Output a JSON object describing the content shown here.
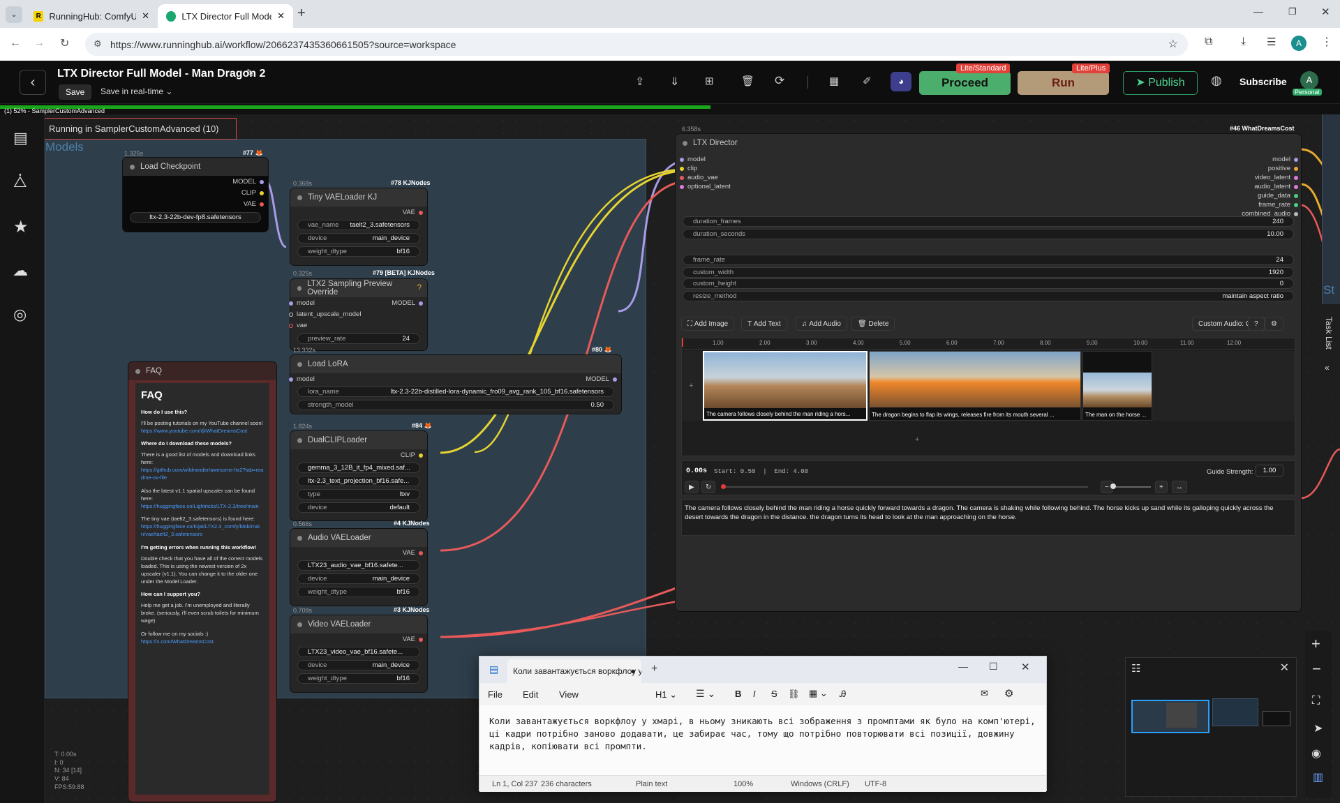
{
  "browser": {
    "tabs": [
      {
        "title": "RunningHub: ComfyUI Cloud, C",
        "favicon": "R"
      },
      {
        "title": "LTX Director Full Model - Man D",
        "favicon": "rh"
      }
    ],
    "url": "https://www.runninghub.ai/workflow/2066237435360661505?source=workspace",
    "profile_initial": "A"
  },
  "app": {
    "workflow_title": "LTX Director Full Model - Man Dragon 2",
    "save_label": "Save",
    "save_mode": "Save in real-time",
    "proceed_label": "Proceed",
    "proceed_badge": "Lite/Standard",
    "run_label": "Run",
    "run_badge": "Lite/Plus",
    "publish_label": "Publish",
    "subscribe_label": "Subscribe",
    "avatar_initial": "A",
    "avatar_badge": "Personal",
    "progress_text": "(1) 52% - SamplerCustomAdvanced",
    "progress_fraction": 0.52
  },
  "canvas": {
    "running_status": "Running in SamplerCustomAdvanced (10)",
    "group_title": "Models",
    "stats": [
      "T: 0.00s",
      "I: 0",
      "N: 34 [14]",
      "V: 84",
      "FPS:59.88"
    ]
  },
  "nodes": {
    "load_checkpoint": {
      "time": "1.325s",
      "tag": "#77 🦊",
      "title": "Load Checkpoint",
      "outputs": [
        "MODEL",
        "CLIP",
        "VAE"
      ],
      "ckpt": "ltx-2.3-22b-dev-fp8.safetensors"
    },
    "tiny_vae": {
      "time": "0.368s",
      "tag": "#78 KJNodes",
      "title": "Tiny VAELoader KJ",
      "output": "VAE",
      "widgets": [
        [
          "vae_name",
          "taelt2_3.safetensors"
        ],
        [
          "device",
          "main_device"
        ],
        [
          "weight_dtype",
          "bf16"
        ]
      ]
    },
    "ltx2_preview": {
      "time": "0.325s",
      "tag": "#79 [BETA] KJNodes",
      "title": "LTX2 Sampling Preview Override",
      "inputs": [
        "model",
        "latent_upscale_model",
        "vae"
      ],
      "output": "MODEL",
      "widget": [
        "preview_rate",
        "24"
      ],
      "help": "?"
    },
    "load_lora": {
      "time": "13.332s",
      "tag": "#80 🦊",
      "title": "Load LoRA",
      "input": "model",
      "output": "MODEL",
      "widgets": [
        [
          "lora_name",
          "ltx-2.3-22b-distilled-lora-dynamic_fro09_avg_rank_105_bf16.safetensors"
        ],
        [
          "strength_model",
          "0.50"
        ]
      ]
    },
    "dual_clip": {
      "time": "1.824s",
      "tag": "#84 🦊",
      "title": "DualCLIPLoader",
      "output": "CLIP",
      "widgets": [
        [
          "",
          "gemma_3_12B_it_fp4_mixed.saf..."
        ],
        [
          "",
          "ltx-2.3_text_projection_bf16.safe..."
        ],
        [
          "type",
          "ltxv"
        ],
        [
          "device",
          "default"
        ]
      ]
    },
    "audio_vae": {
      "time": "0.566s",
      "tag": "#4 KJNodes",
      "title": "Audio VAELoader",
      "output": "VAE",
      "widgets": [
        [
          "",
          "LTX23_audio_vae_bf16.safete..."
        ],
        [
          "device",
          "main_device"
        ],
        [
          "weight_dtype",
          "bf16"
        ]
      ]
    },
    "video_vae": {
      "time": "0.708s",
      "tag": "#3 KJNodes",
      "title": "Video VAELoader",
      "output": "VAE",
      "widgets": [
        [
          "",
          "LTX23_video_vae_bf16.safete..."
        ],
        [
          "device",
          "main_device"
        ],
        [
          "weight_dtype",
          "bf16"
        ]
      ]
    }
  },
  "faq": {
    "node_title": "FAQ",
    "heading": "FAQ",
    "blocks": [
      {
        "q": "How do I use this?",
        "a": "I'll be posting tutorials on my YouTube channel soon!",
        "link": "https://www.youtube.com/@WhatDreamsCost"
      },
      {
        "q": "Where do I download these models?",
        "a": "There is a good list of models and download links here:",
        "link": "https://github.com/wildminder/awesome-ltx2?tab=readme-ov-file"
      },
      {
        "q": "",
        "a": "Also the latest v1.1 spatial upscaler can be found here:",
        "link": "https://huggingface.co/Lightricks/LTX-2.3/tree/main"
      },
      {
        "q": "",
        "a": "The tiny vae (taelt2_3.safetensors) is found here:",
        "link": "https://huggingface.co/Kijai/LTX2.3_comfy/blob/main/vae/taelt2_3.safetensors"
      },
      {
        "q": "I'm getting errors when running this workflow!",
        "a": "Double check that you have all of the correct models loaded. This is using the newest version of 2x upscaler (v1.1). You can change it to the older one under the Model Loader.",
        "link": ""
      },
      {
        "q": "How can I support you?",
        "a": "Help me get a job. I'm unemployed and literally broke. (seriously, i'll even scrub toilets for minimum wage)",
        "link": ""
      },
      {
        "q": "",
        "a": "Or follow me on my socials :)",
        "link": "https://x.com/WhatDreamsCost"
      }
    ]
  },
  "director": {
    "time": "6.358s",
    "tag": "#46 WhatDreamsCost",
    "title": "LTX Director",
    "inputs": [
      "model",
      "clip",
      "audio_vae",
      "optional_latent"
    ],
    "outputs": [
      "model",
      "positive",
      "video_latent",
      "audio_latent",
      "guide_data",
      "frame_rate",
      "combined_audio"
    ],
    "widgets": [
      [
        "duration_frames",
        "240"
      ],
      [
        "duration_seconds",
        "10.00"
      ],
      [
        "frame_rate",
        "24"
      ],
      [
        "custom_width",
        "1920"
      ],
      [
        "custom_height",
        "0"
      ],
      [
        "resize_method",
        "maintain aspect ratio"
      ]
    ],
    "toolbar": [
      "Add Image",
      "Add Text",
      "Add Audio",
      "Delete",
      "Custom Audio: OFF",
      "?"
    ],
    "ruler": [
      "1.00",
      "2.00",
      "3.00",
      "4.00",
      "5.00",
      "6.00",
      "7.00",
      "8.00",
      "9.00",
      "10.00",
      "11.00",
      "12.00"
    ],
    "clips": [
      {
        "caption": "The camera follows closely behind the man riding a hors...",
        "start": 0.5,
        "end": 4.0
      },
      {
        "caption": "The dragon begins to flap its wings, releases fire from its mouth several ...",
        "start": 4.0,
        "end": 8.5
      },
      {
        "caption": "The man on the horse ...",
        "start": 8.5,
        "end": 10.0
      }
    ],
    "time_display": "0.00s",
    "range_text": "Start: 0.50  |  End: 4.00",
    "guide_strength_label": "Guide Strength:",
    "guide_strength": "1.00",
    "prompt": "The camera follows closely behind the man riding a horse quickly forward towards a dragon. The camera is shaking while following behind. The horse kicks up sand while its galloping quickly across the desert towards the dragon in the distance. the dragon turns its head to look at the man approaching on the horse."
  },
  "right_panel": {
    "task_list": "Task List",
    "st": "St"
  },
  "notepad": {
    "tab_title": "Коли завантажується воркфлоу у",
    "menu": [
      "File",
      "Edit",
      "View"
    ],
    "heading_btn": "H1",
    "text": "Коли завантажується воркфлоу у хмарі, в ньому зникають всі зображення з промптами як було на комп'ютері, ці кадри потрібно заново додавати, це забирає час, тому що потрібно повторювати всі позиції, довжину кадрів, копіювати всі промпти.",
    "status": [
      "Ln 1, Col 237",
      "236 characters",
      "Plain text",
      "100%",
      "Windows (CRLF)",
      "UTF-8"
    ]
  },
  "colors": {
    "progress": "#1aa51a",
    "proceed": "#4cae6c",
    "run": "#b39a78",
    "publish": "#1f6f4a",
    "link_yellow": "#e6d431",
    "link_red": "#e85a5a",
    "link_purple": "#a99be6"
  }
}
